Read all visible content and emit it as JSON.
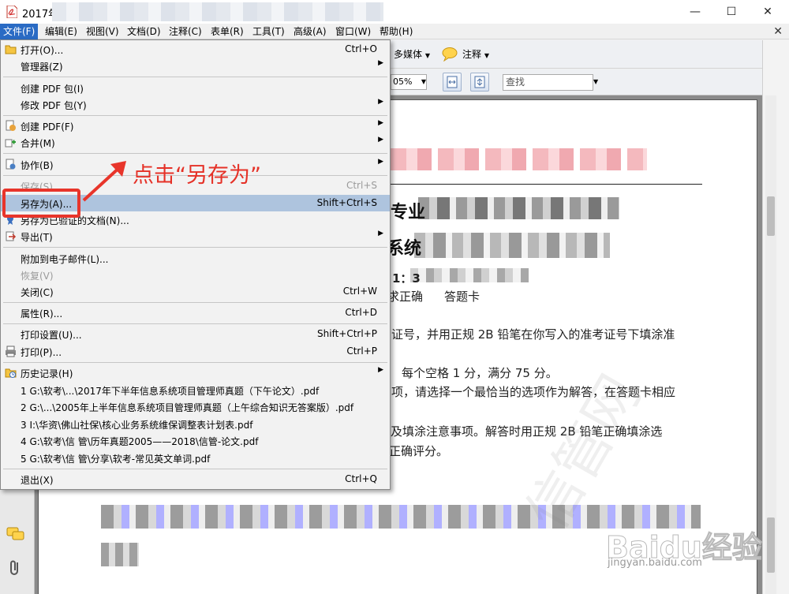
{
  "window": {
    "title": "2017年",
    "controls": [
      "minimize-icon",
      "maximize-icon",
      "close-icon"
    ]
  },
  "menubar": {
    "items": [
      "文件(F)",
      "编辑(E)",
      "视图(V)",
      "文档(D)",
      "注释(C)",
      "表单(R)",
      "工具(T)",
      "高级(A)",
      "窗口(W)",
      "帮助(H)"
    ]
  },
  "toolbar": {
    "multimedia": "多媒体",
    "comment": "注释",
    "zoom": "05%",
    "find_placeholder": "查找"
  },
  "file_menu": {
    "items": [
      {
        "label": "打开(O)...",
        "shortcut": "Ctrl+O",
        "icon": "folder-open-icon"
      },
      {
        "label": "管理器(Z)",
        "submenu": true
      },
      {
        "label": "创建 PDF 包(I)"
      },
      {
        "label": "修改 PDF 包(Y)",
        "submenu": true
      },
      {
        "label": "创建 PDF(F)",
        "submenu": true,
        "icon": "create-pdf-icon"
      },
      {
        "label": "合并(M)",
        "submenu": true,
        "icon": "merge-icon"
      },
      {
        "label": "协作(B)",
        "submenu": true,
        "icon": "collaborate-icon"
      },
      {
        "label": "保存(S)",
        "shortcut": "Ctrl+S",
        "disabled": true
      },
      {
        "label": "另存为(A)...",
        "shortcut": "Shift+Ctrl+S"
      },
      {
        "label": "另存为已验证的文档(N)...",
        "icon": "certified-doc-icon"
      },
      {
        "label": "导出(T)",
        "submenu": true,
        "icon": "export-icon"
      },
      {
        "label": "附加到电子邮件(L)..."
      },
      {
        "label": "恢复(V)",
        "disabled": true
      },
      {
        "label": "关闭(C)",
        "shortcut": "Ctrl+W"
      },
      {
        "label": "属性(R)...",
        "shortcut": "Ctrl+D"
      },
      {
        "label": "打印设置(U)...",
        "shortcut": "Shift+Ctrl+P"
      },
      {
        "label": "打印(P)...",
        "shortcut": "Ctrl+P",
        "icon": "printer-icon"
      },
      {
        "label": "历史记录(H)",
        "submenu": true,
        "icon": "history-icon"
      },
      {
        "label": "1 G:\\软考\\...\\2017年下半年信息系统项目管理师真题（下午论文）.pdf"
      },
      {
        "label": "2 G:\\...\\2005年上半年信息系统项目管理师真题（上午综合知识无答案版）.pdf"
      },
      {
        "label": "3 I:\\华资\\佛山社保\\核心业务系统维保调整表计划表.pdf"
      },
      {
        "label": "4 G:\\软考\\信  管\\历年真题2005——2018\\信管-论文.pdf"
      },
      {
        "label": "5 G:\\软考\\信  管\\分享\\软考-常见英文单词.pdf"
      },
      {
        "label": "退出(X)",
        "shortcut": "Ctrl+Q"
      }
    ]
  },
  "annotation": {
    "text": "点击“另存为”"
  },
  "document": {
    "lines": [
      "专业",
      "系统",
      "1：3",
      "求正确",
      "答题卡",
      "证号，并用正规   2B 铅笔在你写入的准考证号下填涂准",
      "每个空格    1 分，满分 75 分。",
      "项，请选择一个最恰当的选项作为解答，在答题卡相应",
      "及填涂注意事项。解答时用正规  2B     铅笔正确填涂选",
      "正确评分。"
    ]
  },
  "watermark": {
    "brand": "Baidu经验",
    "url": "jingyan.baidu.com",
    "site": "信管网"
  }
}
